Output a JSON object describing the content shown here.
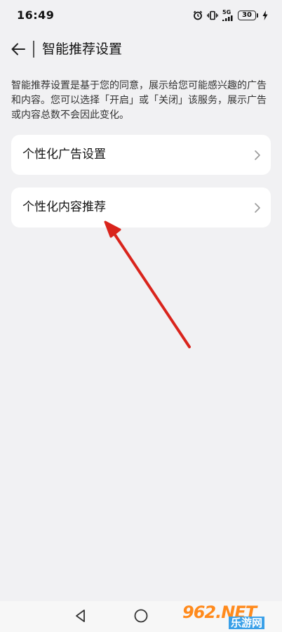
{
  "status_bar": {
    "time": "16:49",
    "network": "5G",
    "battery": "30",
    "icons": [
      "alarm-icon",
      "vibrate-icon",
      "signal-icon",
      "battery-icon",
      "charging-icon"
    ]
  },
  "header": {
    "back_icon": "arrow-left-icon",
    "title": "智能推荐设置"
  },
  "description": "智能推荐设置是基于您的同意，展示给您可能感兴趣的广告和内容。您可以选择「开启」或「关闭」该服务，展示广告或内容总数不会因此变化。",
  "settings": [
    {
      "label": "个性化广告设置",
      "icon": "chevron-right-icon"
    },
    {
      "label": "个性化内容推荐",
      "icon": "chevron-right-icon"
    }
  ],
  "annotation": {
    "color": "#d9241c",
    "icon": "red-arrow-annotation"
  },
  "nav_bar": {
    "back_icon": "triangle-back-icon",
    "home_icon": "circle-home-icon"
  },
  "watermark": {
    "brand": "962.NET",
    "sub": "乐游网",
    "colors": {
      "brand": "#ff8a1c",
      "sub_bg": "#3aa0e8"
    }
  }
}
